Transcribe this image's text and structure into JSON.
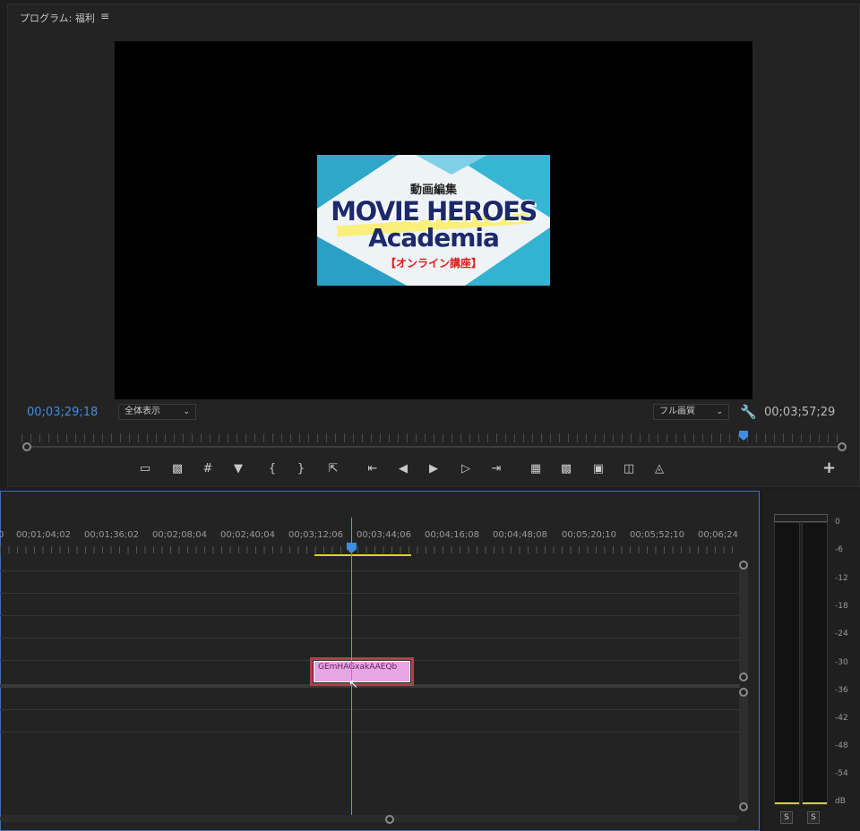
{
  "program_monitor": {
    "title": "プログラム: 福利",
    "menu_icon": "≡",
    "current_timecode": "00;03;29;18",
    "duration_timecode": "00;03;57;29",
    "zoom_select": "全体表示",
    "quality_select": "フル画質",
    "frame": {
      "subtitle": "動画編集",
      "title_line1": "MOVIE HEROES",
      "title_line2": "Academia",
      "tag": "【オンライン講座】"
    },
    "transport_icons": [
      "safe-margins-icon",
      "insert-frame-icon",
      "grid-icon",
      "add-marker-icon",
      "mark-in-icon",
      "mark-out-icon",
      "export-frame-icon",
      "go-to-in-icon",
      "step-back-icon",
      "play-icon",
      "step-forward-icon",
      "go-to-out-icon",
      "lift-icon",
      "extract-icon",
      "camera-icon",
      "comparison-view-icon",
      "proxy-toggle-icon"
    ],
    "add_button": "+",
    "accent_color": "#3d8fe4"
  },
  "timeline": {
    "timecodes": [
      "0",
      "00;01;04;02",
      "00;01;36;02",
      "00;02;08;04",
      "00;02;40;04",
      "00;03;12;06",
      "00;03;44;06",
      "00;04;16;08",
      "00;04;48;08",
      "00;05;20;10",
      "00;05;52;10",
      "00;06;24"
    ],
    "clip": {
      "label": "GEmHAGxakAAEQb",
      "color": "#e7a6e3"
    },
    "in_out_color": "#e4d31a"
  },
  "audio_meter": {
    "scale": [
      "0",
      "-6",
      "-12",
      "-18",
      "-24",
      "-30",
      "-36",
      "-42",
      "-48",
      "-54",
      "dB"
    ],
    "solo_labels": [
      "S",
      "S"
    ]
  }
}
